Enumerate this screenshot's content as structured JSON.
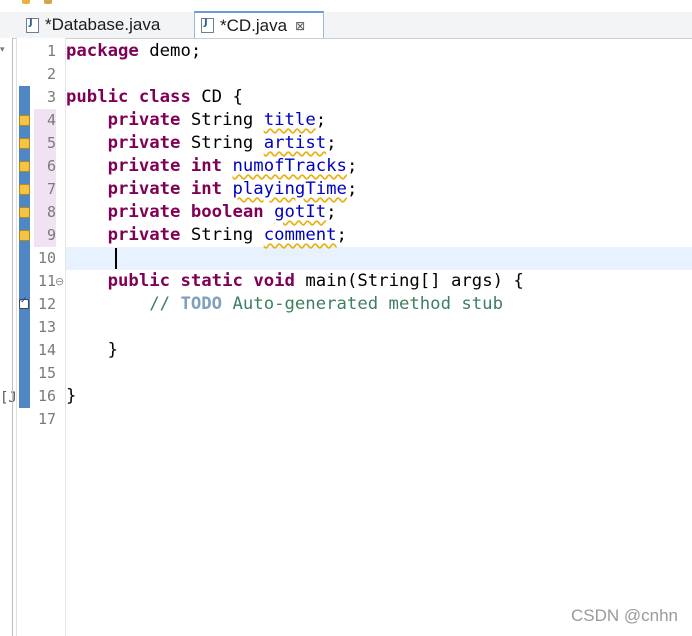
{
  "tabs": [
    {
      "label": "*Database.java",
      "active": false
    },
    {
      "label": "*CD.java",
      "active": true,
      "close_glyph": "⊠"
    }
  ],
  "editor": {
    "language": "java",
    "current_line": 10,
    "lines": [
      {
        "num": "1",
        "annotation": null
      },
      {
        "num": "2",
        "annotation": null
      },
      {
        "num": "3",
        "annotation": null
      },
      {
        "num": "4",
        "annotation": "warning"
      },
      {
        "num": "5",
        "annotation": "warning"
      },
      {
        "num": "6",
        "annotation": "warning"
      },
      {
        "num": "7",
        "annotation": "warning"
      },
      {
        "num": "8",
        "annotation": "warning"
      },
      {
        "num": "9",
        "annotation": "warning"
      },
      {
        "num": "10",
        "annotation": null
      },
      {
        "num": "11",
        "annotation": "fold"
      },
      {
        "num": "12",
        "annotation": "task"
      },
      {
        "num": "13",
        "annotation": null
      },
      {
        "num": "14",
        "annotation": null
      },
      {
        "num": "15",
        "annotation": null
      },
      {
        "num": "16",
        "annotation": null
      },
      {
        "num": "17",
        "annotation": null
      }
    ],
    "tokens": {
      "l1_kw": "package",
      "l1_rest": " demo;",
      "l3_kw1": "public",
      "l3_kw2": "class",
      "l3_rest": " CD {",
      "private": "private",
      "string": " String ",
      "int": "int",
      "boolean": "boolean",
      "f_title": "title",
      "f_artist": "artist",
      "f_tracks": "numofTracks",
      "f_time": "playingTime",
      "f_got": "gotIt",
      "f_comment": "comment",
      "semi": ";",
      "l11_kw1": "public",
      "l11_kw2": "static",
      "l11_kw3": "void",
      "l11_rest": " main(String[] args) {",
      "l12_slash": "// ",
      "l12_todo": "TODO",
      "l12_text": " Auto-generated method stub",
      "l14": "}",
      "l16": "}"
    }
  },
  "gutter_marker": "[J",
  "fold_glyph": "⊖",
  "watermark": "CSDN @cnhn"
}
